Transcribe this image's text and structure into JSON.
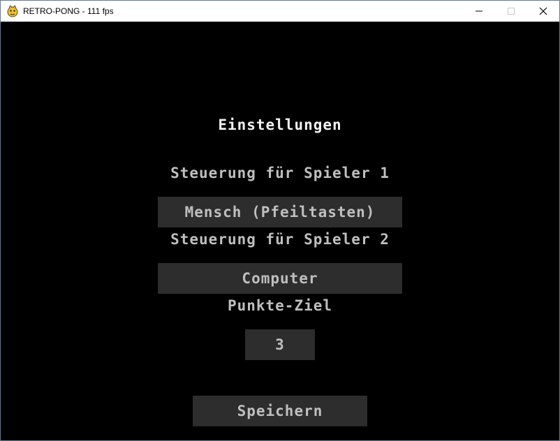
{
  "window": {
    "title": "RETRO-PONG - 111 fps",
    "icon": "pygame-snake-icon",
    "controls": {
      "minimize": "─",
      "maximize": "☐",
      "close": "✕"
    }
  },
  "settings": {
    "heading": "Einstellungen",
    "player1_label": "Steuerung für Spieler 1",
    "player1_value": "Mensch (Pfeiltasten)",
    "player2_label": "Steuerung für Spieler 2",
    "player2_value": "Computer",
    "target_label": "Punkte-Ziel",
    "target_value": "3",
    "save_label": "Speichern"
  },
  "colors": {
    "background": "#000000",
    "button": "#2d2d2d",
    "text": "#bfbfbf",
    "heading": "#f2f2f2"
  }
}
